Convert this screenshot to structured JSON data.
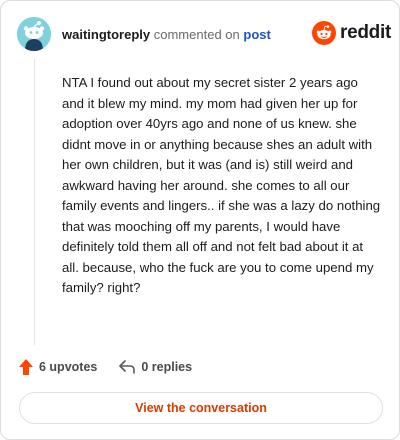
{
  "comment": {
    "username": "waitingtoreply",
    "action_text": "commented on",
    "post_link": "post",
    "body": "NTA I found out about my secret sister 2 years ago and it blew my mind. my mom had given her up for adoption over 40yrs ago and none of us knew. she didnt move in or anything because shes an adult with her own children, but it was (and is) still weird and awkward having her around. she comes to all our family events and lingers.. if she was a lazy do nothing that was mooching off my parents, I would have definitely told them all off and not felt bad about it at all. because, who the fuck are you to come upend my family? right?"
  },
  "brand": {
    "logo_text": "reddit",
    "color": "#ff4500"
  },
  "footer": {
    "upvotes": "6 upvotes",
    "replies": "0 replies",
    "view_button": "View the conversation"
  },
  "colors": {
    "accent": "#d93a00",
    "upvote": "#ff4500",
    "link": "#1a56c4",
    "avatar_bg": "#7ed1dd"
  },
  "icons": {
    "avatar": "snoo-avatar-icon",
    "logo": "reddit-alien-icon",
    "upvote": "upvote-arrow-icon",
    "reply": "reply-arrow-icon"
  }
}
